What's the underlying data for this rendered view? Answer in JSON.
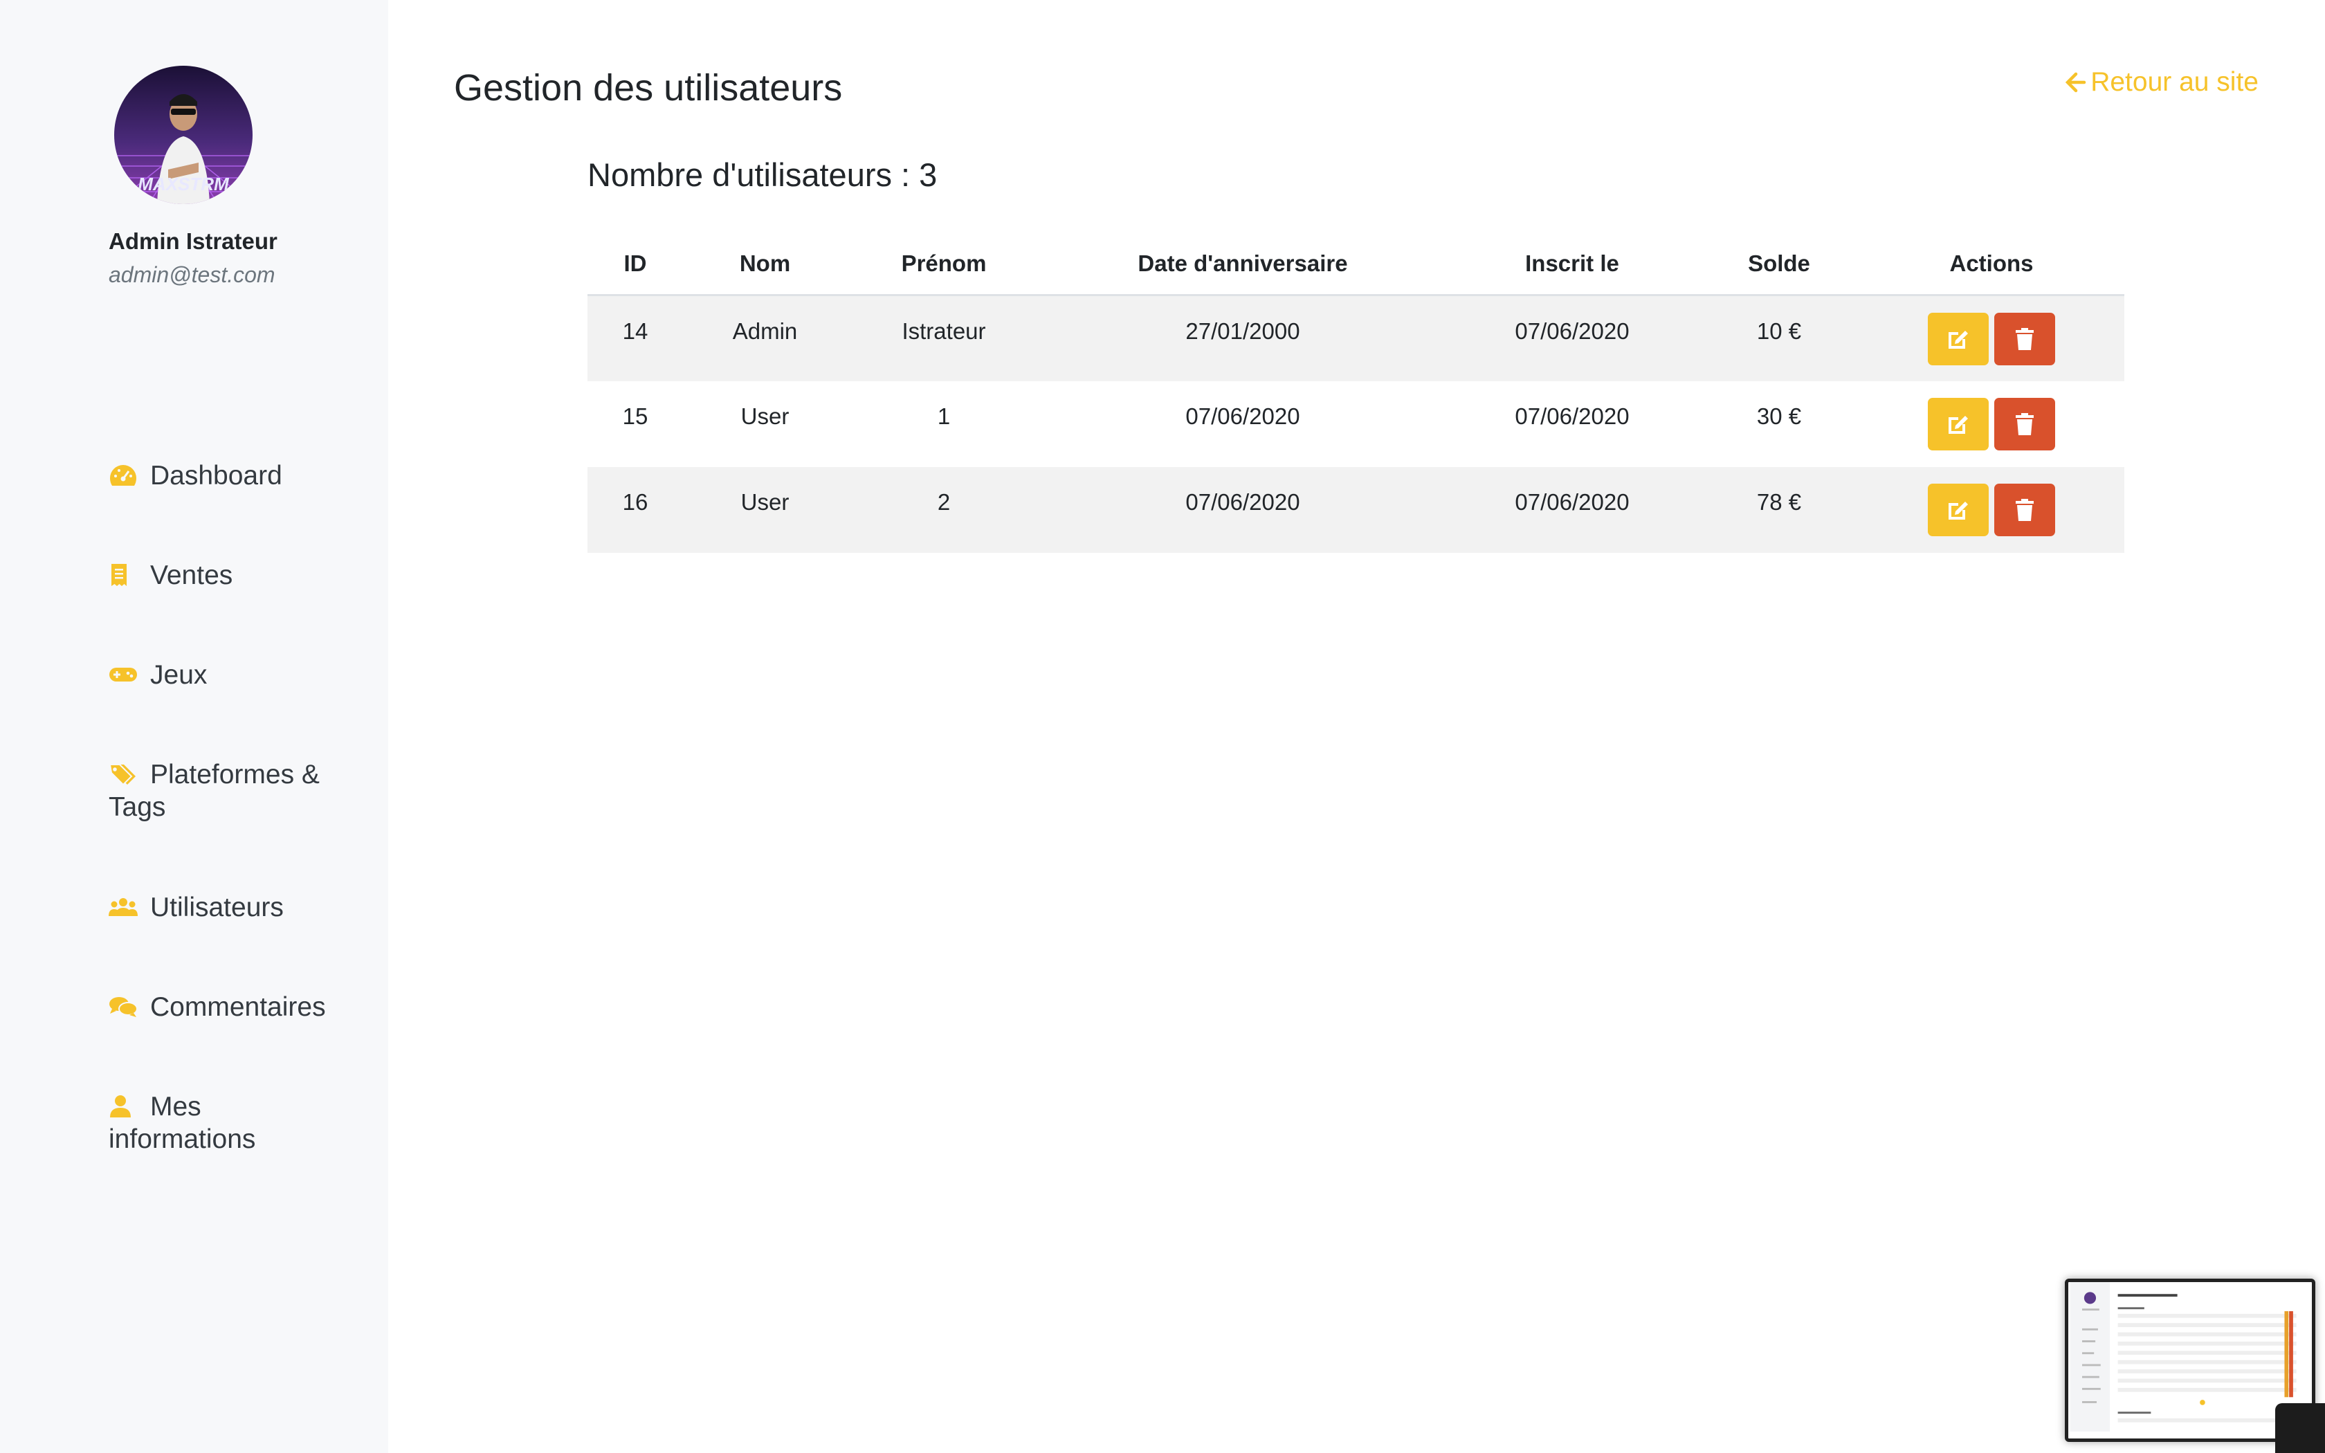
{
  "sidebar": {
    "user_name": "Admin Istrateur",
    "user_email": "admin@test.com",
    "items": [
      {
        "label": "Dashboard",
        "icon": "tachometer-icon"
      },
      {
        "label": "Ventes",
        "icon": "receipt-icon"
      },
      {
        "label": "Jeux",
        "icon": "gamepad-icon"
      },
      {
        "label": "Plateformes & Tags",
        "icon": "tags-icon"
      },
      {
        "label": "Utilisateurs",
        "icon": "users-icon"
      },
      {
        "label": "Commentaires",
        "icon": "comments-icon"
      },
      {
        "label": "Mes informations",
        "icon": "user-icon"
      }
    ]
  },
  "header": {
    "title": "Gestion des utilisateurs",
    "back_link": "Retour au site"
  },
  "main": {
    "count_label": "Nombre d'utilisateurs : 3",
    "table": {
      "columns": [
        "ID",
        "Nom",
        "Prénom",
        "Date d'anniversaire",
        "Inscrit le",
        "Solde",
        "Actions"
      ],
      "rows": [
        {
          "id": "14",
          "nom": "Admin",
          "prenom": "Istrateur",
          "anniversaire": "27/01/2000",
          "inscrit": "07/06/2020",
          "solde": "10 €"
        },
        {
          "id": "15",
          "nom": "User",
          "prenom": "1",
          "anniversaire": "07/06/2020",
          "inscrit": "07/06/2020",
          "solde": "30 €"
        },
        {
          "id": "16",
          "nom": "User",
          "prenom": "2",
          "anniversaire": "07/06/2020",
          "inscrit": "07/06/2020",
          "solde": "78 €"
        }
      ]
    }
  },
  "colors": {
    "accent": "#f6c22a",
    "danger": "#d9512c",
    "sidebar_bg": "#f7f8fa"
  }
}
